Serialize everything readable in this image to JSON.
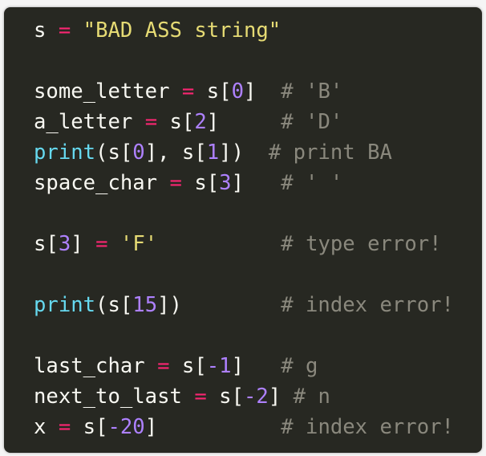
{
  "code": {
    "lines": [
      [
        {
          "t": "s ",
          "c": "plain"
        },
        {
          "t": "=",
          "c": "op"
        },
        {
          "t": " ",
          "c": "plain"
        },
        {
          "t": "\"BAD ASS string\"",
          "c": "str"
        }
      ],
      [],
      [
        {
          "t": "some_letter ",
          "c": "plain"
        },
        {
          "t": "=",
          "c": "op"
        },
        {
          "t": " s[",
          "c": "plain"
        },
        {
          "t": "0",
          "c": "num"
        },
        {
          "t": "]  ",
          "c": "plain"
        },
        {
          "t": "# 'B'",
          "c": "cmt"
        }
      ],
      [
        {
          "t": "a_letter ",
          "c": "plain"
        },
        {
          "t": "=",
          "c": "op"
        },
        {
          "t": " s[",
          "c": "plain"
        },
        {
          "t": "2",
          "c": "num"
        },
        {
          "t": "]     ",
          "c": "plain"
        },
        {
          "t": "# 'D'",
          "c": "cmt"
        }
      ],
      [
        {
          "t": "print",
          "c": "fn"
        },
        {
          "t": "(s[",
          "c": "plain"
        },
        {
          "t": "0",
          "c": "num"
        },
        {
          "t": "], s[",
          "c": "plain"
        },
        {
          "t": "1",
          "c": "num"
        },
        {
          "t": "])  ",
          "c": "plain"
        },
        {
          "t": "# print BA",
          "c": "cmt"
        }
      ],
      [
        {
          "t": "space_char ",
          "c": "plain"
        },
        {
          "t": "=",
          "c": "op"
        },
        {
          "t": " s[",
          "c": "plain"
        },
        {
          "t": "3",
          "c": "num"
        },
        {
          "t": "]   ",
          "c": "plain"
        },
        {
          "t": "# ' '",
          "c": "cmt"
        }
      ],
      [],
      [
        {
          "t": "s[",
          "c": "plain"
        },
        {
          "t": "3",
          "c": "num"
        },
        {
          "t": "] ",
          "c": "plain"
        },
        {
          "t": "=",
          "c": "op"
        },
        {
          "t": " ",
          "c": "plain"
        },
        {
          "t": "'F'",
          "c": "str"
        },
        {
          "t": "          ",
          "c": "plain"
        },
        {
          "t": "# type error!",
          "c": "cmt"
        }
      ],
      [],
      [
        {
          "t": "print",
          "c": "fn"
        },
        {
          "t": "(s[",
          "c": "plain"
        },
        {
          "t": "15",
          "c": "num"
        },
        {
          "t": "])        ",
          "c": "plain"
        },
        {
          "t": "# index error!",
          "c": "cmt"
        }
      ],
      [],
      [
        {
          "t": "last_char ",
          "c": "plain"
        },
        {
          "t": "=",
          "c": "op"
        },
        {
          "t": " s[",
          "c": "plain"
        },
        {
          "t": "-1",
          "c": "num"
        },
        {
          "t": "]   ",
          "c": "plain"
        },
        {
          "t": "# g",
          "c": "cmt"
        }
      ],
      [
        {
          "t": "next_to_last ",
          "c": "plain"
        },
        {
          "t": "=",
          "c": "op"
        },
        {
          "t": " s[",
          "c": "plain"
        },
        {
          "t": "-2",
          "c": "num"
        },
        {
          "t": "] ",
          "c": "plain"
        },
        {
          "t": "# n",
          "c": "cmt"
        }
      ],
      [
        {
          "t": "x ",
          "c": "plain"
        },
        {
          "t": "=",
          "c": "op"
        },
        {
          "t": " s[",
          "c": "plain"
        },
        {
          "t": "-20",
          "c": "num"
        },
        {
          "t": "]          ",
          "c": "plain"
        },
        {
          "t": "# index error!",
          "c": "cmt"
        }
      ]
    ]
  },
  "theme": {
    "background": "#272822",
    "plain": "#f8f8f2",
    "operator": "#f92672",
    "string": "#e6db74",
    "number": "#ae81ff",
    "function": "#66d9ef",
    "comment": "#8a887d"
  }
}
